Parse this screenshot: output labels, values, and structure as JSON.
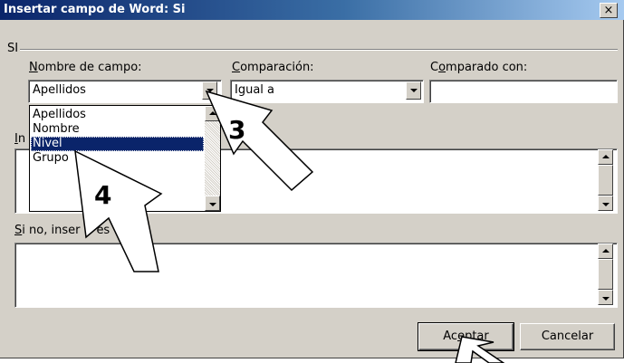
{
  "dialog": {
    "title": "Insertar campo de Word: Si",
    "close_glyph": "×"
  },
  "group": {
    "label": "SI"
  },
  "field_name": {
    "label_accel": "N",
    "label_rest": "ombre de campo:",
    "value": "Apellidos",
    "options": [
      "Apellidos",
      "Nombre",
      "Nivel",
      "Grupo"
    ],
    "highlighted": "Nivel"
  },
  "comparison": {
    "label_accel": "C",
    "label_rest": "omparación:",
    "value": "Igual a"
  },
  "compare_to": {
    "label_pre": "C",
    "label_accel": "o",
    "label_rest": "mparado con:",
    "value": ""
  },
  "insert_text": {
    "label_partial": "In"
  },
  "else_text": {
    "label_accel": "S",
    "label_part1": "i no, inser",
    "label_part2": "es",
    "label_part3": "tro:"
  },
  "buttons": {
    "ok_pre": "Ac",
    "ok_accel": "e",
    "ok_post": "ptar",
    "cancel": "Cancelar"
  },
  "callouts": [
    "3",
    "4"
  ]
}
